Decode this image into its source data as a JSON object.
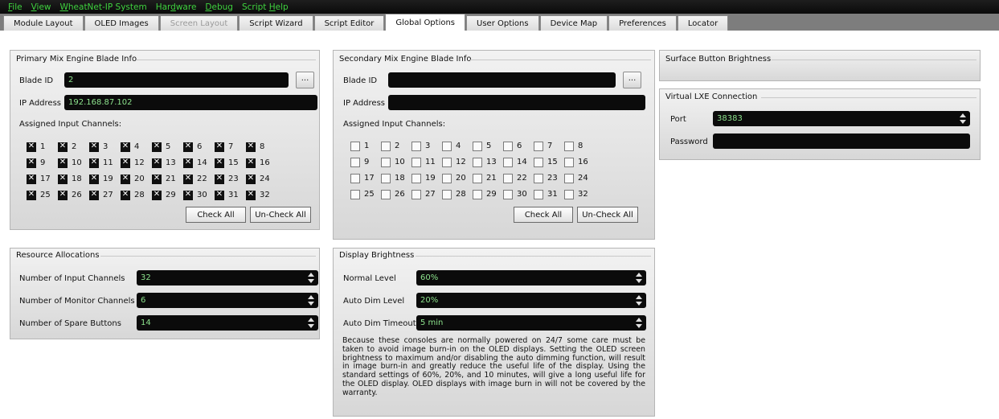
{
  "menu": [
    {
      "label": "File",
      "u": 0
    },
    {
      "label": "View",
      "u": 0
    },
    {
      "label": "WheatNet-IP System",
      "u": 0
    },
    {
      "label": "Hardware",
      "u": 3
    },
    {
      "label": "Debug",
      "u": 0
    },
    {
      "label": "Script Help",
      "u": 7
    }
  ],
  "tabs": [
    {
      "label": "Module Layout",
      "state": "normal"
    },
    {
      "label": "OLED Images",
      "state": "normal"
    },
    {
      "label": "Screen Layout",
      "state": "disabled"
    },
    {
      "label": "Script Wizard",
      "state": "normal"
    },
    {
      "label": "Script Editor",
      "state": "normal"
    },
    {
      "label": "Global Options",
      "state": "active"
    },
    {
      "label": "User Options",
      "state": "normal"
    },
    {
      "label": "Device Map",
      "state": "normal"
    },
    {
      "label": "Preferences",
      "state": "normal"
    },
    {
      "label": "Locator",
      "state": "normal"
    }
  ],
  "primary": {
    "title": "Primary Mix Engine Blade Info",
    "blade_id_label": "Blade ID",
    "blade_id": "2",
    "ip_label": "IP Address",
    "ip": "192.168.87.102",
    "channels_label": "Assigned Input Channels:",
    "checked": true,
    "check_all": "Check All",
    "uncheck_all": "Un-Check All",
    "browse": "..."
  },
  "secondary": {
    "title": "Secondary Mix Engine Blade Info",
    "blade_id_label": "Blade ID",
    "blade_id": "",
    "ip_label": "IP Address",
    "ip": "",
    "channels_label": "Assigned Input Channels:",
    "checked": false,
    "check_all": "Check All",
    "uncheck_all": "Un-Check All",
    "browse": "..."
  },
  "surface": {
    "title": "Surface Button Brightness"
  },
  "virtual_lxe": {
    "title": "Virtual LXE Connection",
    "port_label": "Port",
    "port": "38383",
    "password_label": "Password",
    "password": ""
  },
  "resources": {
    "title": "Resource Allocations",
    "rows": [
      {
        "label": "Number of Input Channels",
        "value": "32"
      },
      {
        "label": "Number of Monitor Channels",
        "value": "6"
      },
      {
        "label": "Number of Spare Buttons",
        "value": "14"
      }
    ]
  },
  "display": {
    "title": "Display Brightness",
    "rows": [
      {
        "label": "Normal Level",
        "value": "60%"
      },
      {
        "label": "Auto Dim Level",
        "value": "20%"
      },
      {
        "label": "Auto Dim Timeout",
        "value": "5 min"
      }
    ],
    "warning": "Because these consoles are normally powered on 24/7 some care must be taken to avoid image burn-in on the OLED displays. Setting the OLED screen brightness to maximum and/or disabling the auto dimming function, will result in image burn-in and greatly reduce the useful life of the display. Using the standard settings of 60%, 20%, and 10 minutes, will give a long useful life for the OLED display. OLED displays with image burn in will not be covered by the warranty."
  },
  "channel_count": 32,
  "colors": {
    "menu_text": "#3fd23f",
    "field_bg": "#0b0b0b",
    "field_text": "#8ce28c",
    "tabbar_bg": "#7d7d7d"
  }
}
